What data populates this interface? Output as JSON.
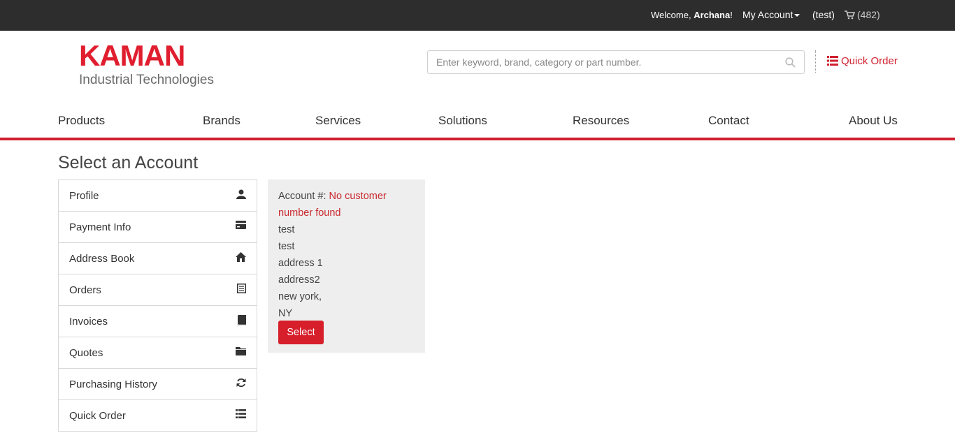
{
  "topbar": {
    "welcome_prefix": "Welcome,",
    "user_name": "Archana",
    "welcome_suffix": "!",
    "my_account": "My Account",
    "account_name": "(test)",
    "cart_count": "(482)"
  },
  "logo": {
    "brand": "KAMAN",
    "subtitle": "Industrial Technologies"
  },
  "search": {
    "placeholder": "Enter keyword, brand, category or part number."
  },
  "quick_order": "Quick Order",
  "nav": [
    "Products",
    "Brands",
    "Services",
    "Solutions",
    "Resources",
    "Contact",
    "About Us"
  ],
  "page_title": "Select an Account",
  "sidebar": [
    {
      "label": "Profile",
      "icon": "user-icon"
    },
    {
      "label": "Payment Info",
      "icon": "credit-card-icon"
    },
    {
      "label": "Address Book",
      "icon": "home-icon"
    },
    {
      "label": "Orders",
      "icon": "list-alt-icon"
    },
    {
      "label": "Invoices",
      "icon": "book-icon"
    },
    {
      "label": "Quotes",
      "icon": "folder-icon"
    },
    {
      "label": "Purchasing History",
      "icon": "refresh-icon"
    },
    {
      "label": "Quick Order",
      "icon": "list-icon"
    }
  ],
  "account_card": {
    "account_label": "Account #:",
    "account_value_line1": "No customer",
    "account_value_line2": "number found",
    "lines": [
      "test",
      "test",
      "address 1",
      "address2",
      "new york,",
      "NY"
    ],
    "select_label": "Select"
  },
  "colors": {
    "brand_red": "#e01e2f",
    "topbar_bg": "#2d2d2d",
    "card_bg": "#eeeeee"
  }
}
